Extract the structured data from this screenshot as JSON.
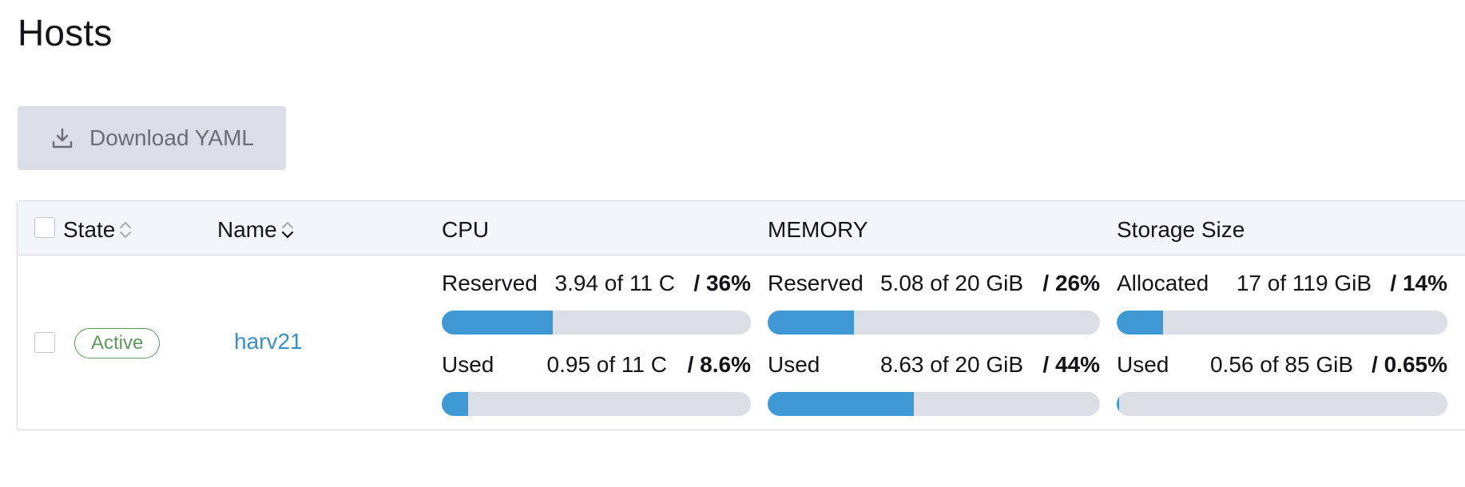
{
  "page": {
    "title": "Hosts"
  },
  "toolbar": {
    "download_label": "Download YAML"
  },
  "table": {
    "columns": {
      "state": "State",
      "name": "Name",
      "cpu": "CPU",
      "memory": "MEMORY",
      "storage": "Storage Size"
    },
    "rows": [
      {
        "state": "Active",
        "name": "harv21",
        "cpu": {
          "reserved": {
            "label": "Reserved",
            "value": "3.94 of 11 C",
            "pct": "/ 36%",
            "fraction": 0.36
          },
          "used": {
            "label": "Used",
            "value": "0.95 of 11 C",
            "pct": "/ 8.6%",
            "fraction": 0.086
          }
        },
        "memory": {
          "reserved": {
            "label": "Reserved",
            "value": "5.08 of 20 GiB",
            "pct": "/ 26%",
            "fraction": 0.26
          },
          "used": {
            "label": "Used",
            "value": "8.63 of 20 GiB",
            "pct": "/ 44%",
            "fraction": 0.44
          }
        },
        "storage": {
          "allocated": {
            "label": "Allocated",
            "value": "17 of 119 GiB",
            "pct": "/ 14%",
            "fraction": 0.14
          },
          "used": {
            "label": "Used",
            "value": "0.56 of 85 GiB",
            "pct": "/ 0.65%",
            "fraction": 0.0065
          }
        }
      }
    ]
  },
  "colors": {
    "accent": "#3d98d3",
    "bar_track": "#dcdee6",
    "active": "#5d995d",
    "link": "#3b8fc9",
    "button_bg": "#dcdee7"
  },
  "icons": {
    "download": "download-icon",
    "sort": "sort-icon"
  }
}
